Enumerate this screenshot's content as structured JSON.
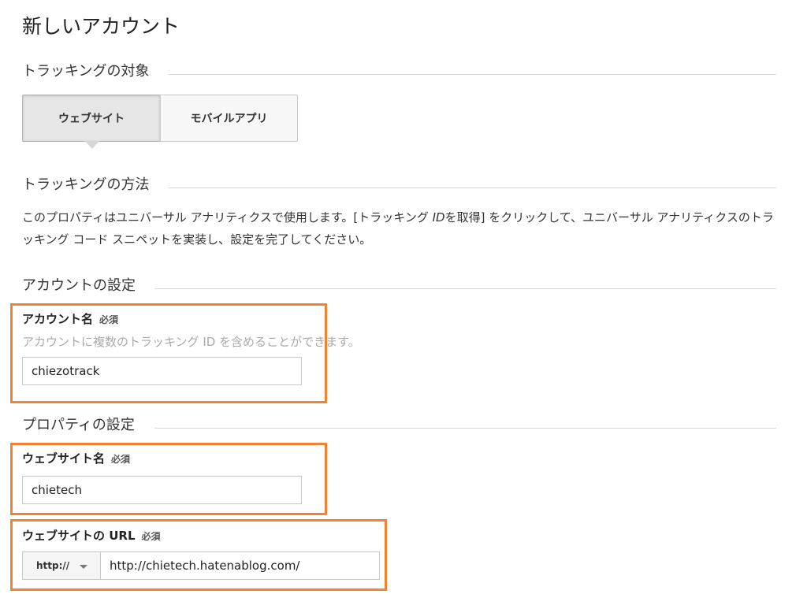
{
  "page": {
    "title": "新しいアカウント"
  },
  "tracking_target": {
    "heading": "トラッキングの対象",
    "options": [
      {
        "label": "ウェブサイト",
        "selected": true
      },
      {
        "label": "モバイルアプリ",
        "selected": false
      }
    ]
  },
  "tracking_method": {
    "heading": "トラッキングの方法",
    "description_part1": "このプロパティはユニバーサル アナリティクスで使用します。[トラッキング ",
    "description_id": "ID",
    "description_part2": "を取得] をクリックして、ユニバーサル アナリティクスのトラッキング コード スニペットを実装し、設定を完了してください。"
  },
  "account_settings": {
    "heading": "アカウントの設定",
    "account_name": {
      "label": "アカウント名",
      "required": "必須",
      "hint": "アカウントに複数のトラッキング ID を含めることができます。",
      "value": "chiezotrack"
    }
  },
  "property_settings": {
    "heading": "プロパティの設定",
    "website_name": {
      "label": "ウェブサイト名",
      "required": "必須",
      "value": "chietech"
    },
    "website_url": {
      "label": "ウェブサイトの URL",
      "required": "必須",
      "protocol": "http://",
      "value": "http://chietech.hatenablog.com/"
    }
  },
  "colors": {
    "highlight": "#f08232",
    "rule": "#d9d9d9"
  }
}
